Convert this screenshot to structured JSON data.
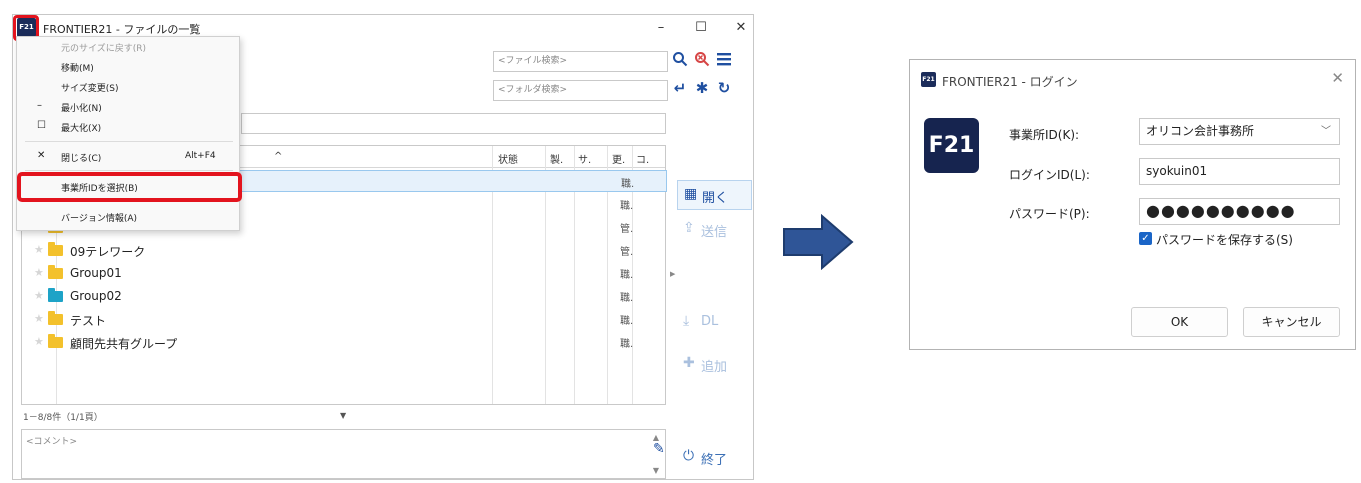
{
  "main_window": {
    "title": "FRONTIER21 - ファイルの一覧",
    "app_icon_text": "F21",
    "controls": {
      "minimize": "–",
      "maximize": "☐",
      "close": "✕"
    },
    "file_search_placeholder": "<ファイル検索>",
    "folder_search_placeholder": "<フォルダ検索>",
    "columns": {
      "sort_arrow": "^",
      "status": "状態",
      "col_a": "製.",
      "col_b": "サ.",
      "updated": "更.",
      "col_c": "コ."
    },
    "rows": [
      {
        "name": "",
        "updated": "職.",
        "color": "yellow"
      },
      {
        "name": "",
        "updated": "職.",
        "color": "yellow"
      },
      {
        "name": "",
        "updated": "管.",
        "color": "yellow"
      },
      {
        "name": "09テレワーク",
        "updated": "管.",
        "color": "yellow"
      },
      {
        "name": "Group01",
        "updated": "職.",
        "color": "yellow"
      },
      {
        "name": "Group02",
        "updated": "職.",
        "color": "teal"
      },
      {
        "name": "テスト",
        "updated": "職.",
        "color": "yellow"
      },
      {
        "name": "顧問先共有グループ",
        "updated": "職.",
        "color": "yellow"
      }
    ],
    "status_text": "1－8/8件（1/1頁）",
    "comment_placeholder": "<コメント>",
    "side_buttons": {
      "open": "開く",
      "send": "送信",
      "download": "DL",
      "add": "追加",
      "exit": "終了"
    }
  },
  "context_menu": {
    "items": [
      {
        "label": "元のサイズに戻す(R)",
        "disabled": true,
        "icon": ""
      },
      {
        "label": "移動(M)",
        "disabled": false,
        "icon": ""
      },
      {
        "label": "サイズ変更(S)",
        "disabled": false,
        "icon": ""
      },
      {
        "label": "最小化(N)",
        "disabled": false,
        "icon": "–"
      },
      {
        "label": "最大化(X)",
        "disabled": false,
        "icon": "☐"
      },
      {
        "label": "閉じる(C)",
        "disabled": false,
        "icon": "✕",
        "shortcut": "Alt+F4"
      },
      {
        "label": "事業所IDを選択(B)",
        "disabled": false,
        "icon": ""
      },
      {
        "label": "バージョン情報(A)",
        "disabled": false,
        "icon": ""
      }
    ]
  },
  "login_dialog": {
    "title": "FRONTIER21 - ログイン",
    "icon_text": "F21",
    "logo_text": "F21",
    "close": "✕",
    "office_id_label": "事業所ID(K):",
    "office_id_value": "オリコン会計事務所",
    "login_id_label": "ログインID(L):",
    "login_id_value": "syokuin01",
    "password_label": "パスワード(P):",
    "password_value": "●●●●●●●●●●",
    "save_password_label": "パスワードを保存する(S)",
    "save_password_checked": true,
    "ok_label": "OK",
    "cancel_label": "キャンセル"
  },
  "colors": {
    "highlight": "#e3141e",
    "accent": "#1f4fa0",
    "arrow": "#2f5597"
  }
}
